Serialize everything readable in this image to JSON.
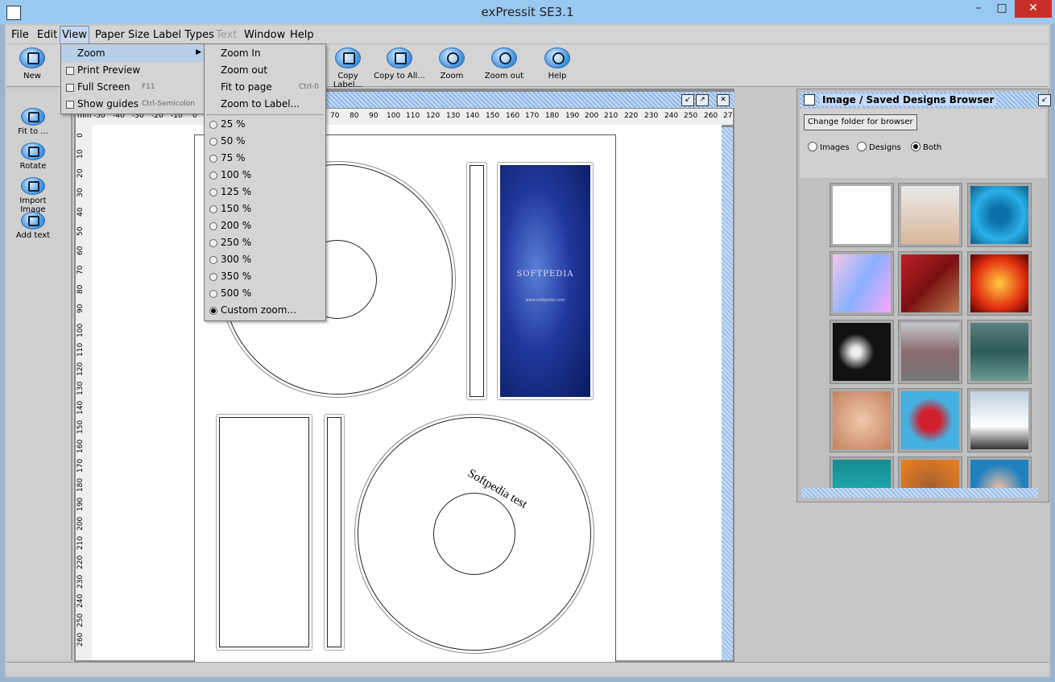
{
  "window": {
    "title": "exPressit SE3.1",
    "min": "–",
    "max": "□",
    "close": "✕"
  },
  "menubar": [
    "File",
    "Edit",
    "View",
    "Paper Size",
    "Label Types",
    "Text",
    "Window",
    "Help"
  ],
  "toolbar": {
    "new": "New",
    "copy_label": "Copy Label...",
    "copy_all": "Copy to All...",
    "zoom": "Zoom",
    "zoom_out": "Zoom out",
    "help": "Help"
  },
  "left_tools": {
    "fit": "Fit to ...",
    "rotate": "Rotate",
    "import_image": "Import Image",
    "add_text": "Add text"
  },
  "view_menu": {
    "zoom": "Zoom",
    "print_preview": "Print Preview",
    "full_screen": "Full Screen",
    "full_screen_sc": "F11",
    "show_guides": "Show guides",
    "show_guides_sc": "Ctrl-Semicolon"
  },
  "zoom_menu": {
    "zoom_in": "Zoom In",
    "zoom_out": "Zoom out",
    "fit_to_page": "Fit to page",
    "fit_to_page_sc": "Ctrl-0",
    "zoom_to_label": "Zoom to Label...",
    "levels": [
      "25 %",
      "50 %",
      "75 %",
      "100 %",
      "125 %",
      "150 %",
      "200 %",
      "250 %",
      "300 %",
      "350 %",
      "500 %"
    ],
    "custom": "Custom zoom...",
    "selected": "Custom zoom..."
  },
  "ruler": {
    "unit": "mm",
    "h_ticks": [
      "-50",
      "-40",
      "-30",
      "-20",
      "-10",
      "0",
      "70",
      "80",
      "90",
      "100",
      "110",
      "120",
      "130",
      "140",
      "150",
      "160",
      "170",
      "180",
      "190",
      "200",
      "210",
      "220",
      "230",
      "240",
      "250",
      "260",
      "27"
    ],
    "v_ticks": [
      "0",
      "10",
      "20",
      "30",
      "40",
      "50",
      "60",
      "70",
      "80",
      "90",
      "100",
      "110",
      "120",
      "130",
      "140",
      "150",
      "160",
      "170",
      "180",
      "190",
      "200",
      "210",
      "220",
      "230",
      "240",
      "250",
      "260"
    ]
  },
  "canvas": {
    "cover_text": "SOFTPEDIA",
    "cover_sub": "www.softpedia.com",
    "disc_text": "Softpedia test"
  },
  "browser": {
    "title": "Image / Saved Designs Browser",
    "change_folder": "Change folder for browser",
    "radio_images": "Images",
    "radio_designs": "Designs",
    "radio_both": "Both",
    "selected_filter": "Both"
  },
  "colors": {
    "accent": "#3d8fe0",
    "close": "#c7302a",
    "titlebar": "#99c8f1"
  }
}
